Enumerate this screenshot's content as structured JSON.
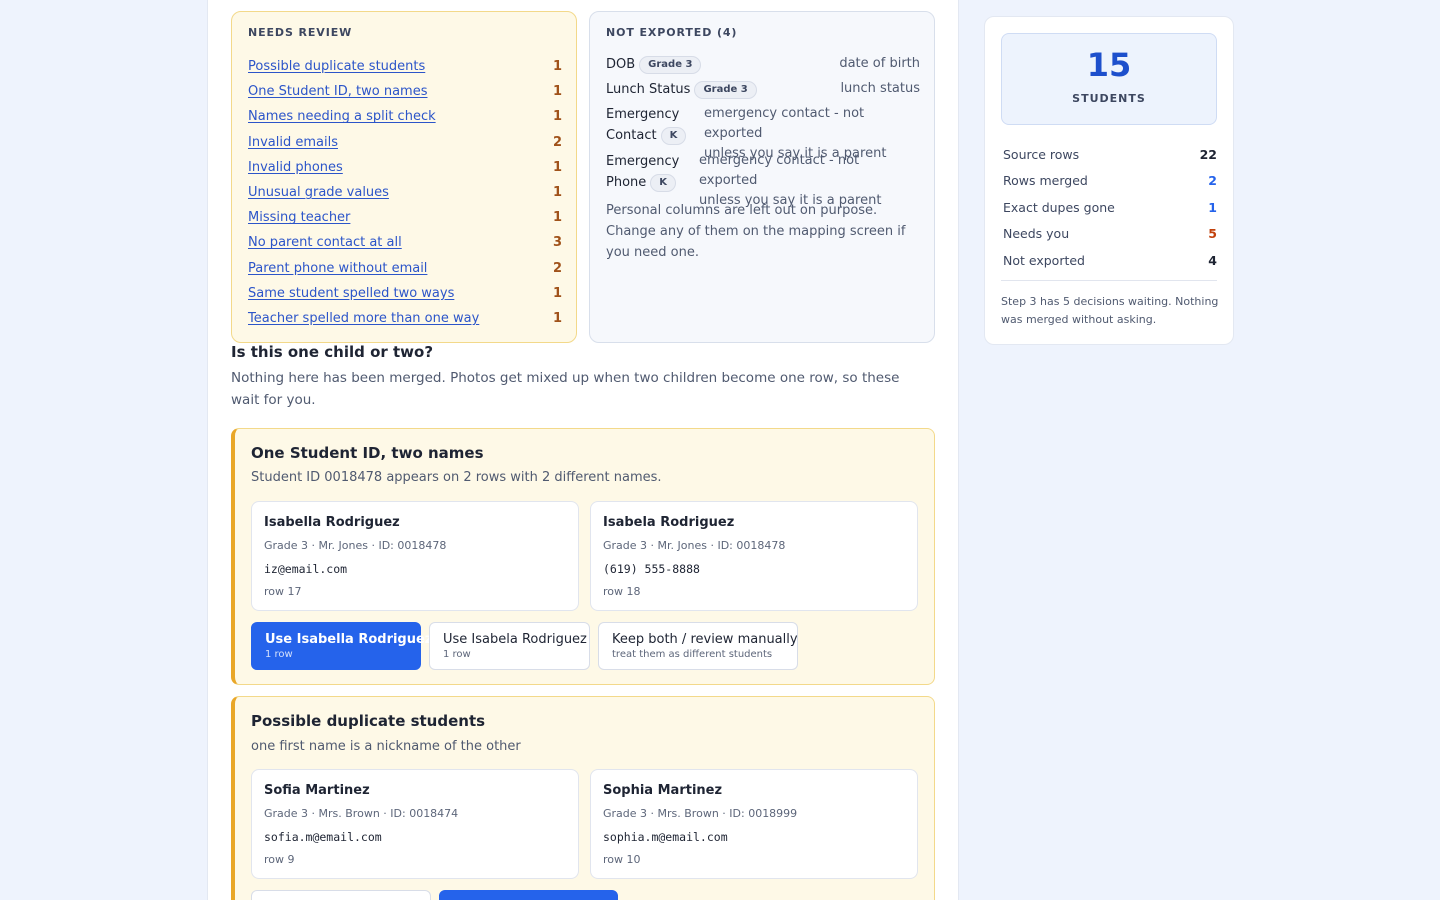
{
  "needs_review": {
    "title": "NEEDS REVIEW",
    "items": [
      {
        "label": "Possible duplicate students",
        "count": "1"
      },
      {
        "label": "One Student ID, two names",
        "count": "1"
      },
      {
        "label": "Names needing a split check",
        "count": "1"
      },
      {
        "label": "Invalid emails",
        "count": "2"
      },
      {
        "label": "Invalid phones",
        "count": "1"
      },
      {
        "label": "Unusual grade values",
        "count": "1"
      },
      {
        "label": "Missing teacher",
        "count": "1"
      },
      {
        "label": "No parent contact at all",
        "count": "3"
      },
      {
        "label": "Parent phone without email",
        "count": "2"
      },
      {
        "label": "Same student spelled two ways",
        "count": "1"
      },
      {
        "label": "Teacher spelled more than one way",
        "count": "1"
      }
    ]
  },
  "not_exported": {
    "title": "NOT EXPORTED (4)",
    "items": [
      {
        "name": "DOB",
        "pill": "Grade 3",
        "desc": "date of birth"
      },
      {
        "name": "Lunch Status",
        "pill": "Grade 3",
        "desc": "lunch status"
      },
      {
        "name_line1": "Emergency",
        "name_line2": "Contact",
        "pill": "K",
        "desc_line1": "emergency contact - not exported",
        "desc_line2": "unless you say it is a parent"
      },
      {
        "name_line1": "Emergency",
        "name_line2": "Phone",
        "pill": "K",
        "desc_line1": "emergency contact - not exported",
        "desc_line2": "unless you say it is a parent"
      }
    ],
    "note": "Personal columns are left out on purpose. Change any of them on the mapping screen if you need one."
  },
  "section": {
    "title": "Is this one child or two?",
    "desc": "Nothing here has been merged. Photos get mixed up when two children become one row, so these wait for you."
  },
  "cards": [
    {
      "title": "One Student ID, two names",
      "desc": "Student ID 0018478 appears on 2 rows with 2 different names.",
      "records": [
        {
          "name": "Isabella Rodriguez",
          "meta": "Grade 3 · Mr. Jones · ID: 0018478",
          "contact": "iz@email.com",
          "row": "row 17"
        },
        {
          "name": "Isabela Rodriguez",
          "meta": "Grade 3 · Mr. Jones · ID: 0018478",
          "contact": "(619) 555-8888",
          "row": "row 18"
        }
      ],
      "actions": [
        {
          "label": "Use Isabella Rodriguez",
          "sub": "1 row"
        },
        {
          "label": "Use Isabela Rodriguez",
          "sub": "1 row"
        },
        {
          "label": "Keep both / review manually",
          "sub": "treat them as different students"
        }
      ]
    },
    {
      "title": "Possible duplicate students",
      "desc": "one first name is a nickname of the other",
      "records": [
        {
          "name": "Sofia Martinez",
          "meta": "Grade 3 · Mrs. Brown · ID: 0018474",
          "contact": "sofia.m@email.com",
          "row": "row 9"
        },
        {
          "name": "Sophia Martinez",
          "meta": "Grade 3 · Mrs. Brown · ID: 0018999",
          "contact": "sophia.m@email.com",
          "row": "row 10"
        }
      ]
    }
  ],
  "summary": {
    "count": "15",
    "count_label": "STUDENTS",
    "stats": [
      {
        "label": "Source rows",
        "value": "22",
        "color": "#1e2433"
      },
      {
        "label": "Rows merged",
        "value": "2",
        "color": "#2563eb"
      },
      {
        "label": "Exact dupes gone",
        "value": "1",
        "color": "#2563eb"
      },
      {
        "label": "Needs you",
        "value": "5",
        "color": "#c2410c"
      },
      {
        "label": "Not exported",
        "value": "4",
        "color": "#1e2433"
      }
    ],
    "note": "Step 3 has 5 decisions waiting. Nothing was merged without asking."
  },
  "colors": {
    "accent": "#2563eb",
    "warning_border": "#e9a728",
    "count_warn": "#a0521a"
  }
}
